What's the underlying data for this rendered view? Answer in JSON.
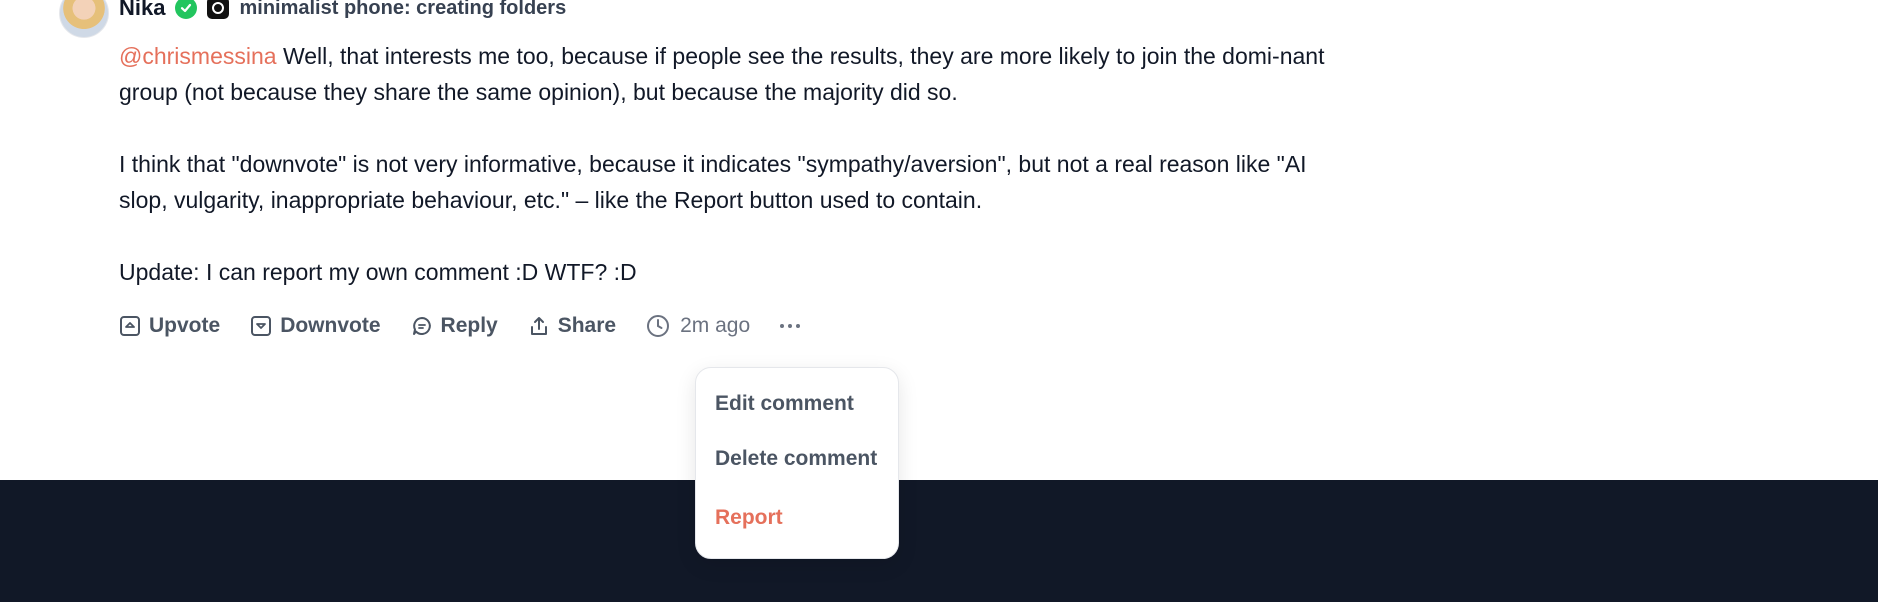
{
  "comment": {
    "author": "Nika",
    "product": "minimalist phone: creating folders",
    "mention": "@chrismessina",
    "paragraph1": " Well, that interests me too, because if people see the results, they are more likely to join the domi-nant group (not because they share the same opinion), but because the majority did so.",
    "paragraph2": "I think that \"downvote\" is not very informative, because it indicates \"sympathy/aversion\", but not a real reason like \"AI slop, vulgarity, inappropriate behaviour, etc.\" – like the Report button used to contain.",
    "paragraph3": "Update: I can report my own comment :D WTF? :D"
  },
  "actions": {
    "upvote": "Upvote",
    "downvote": "Downvote",
    "reply": "Reply",
    "share": "Share",
    "time": "2m ago"
  },
  "menu": {
    "edit": "Edit comment",
    "delete": "Delete comment",
    "report": "Report"
  },
  "icons": {
    "verified": "verified-check-icon",
    "product": "product-logo-icon",
    "upvote": "upvote-icon",
    "downvote": "downvote-icon",
    "reply": "reply-bubble-icon",
    "share": "share-icon",
    "time": "clock-icon",
    "more": "more-dots-icon"
  },
  "colors": {
    "mention": "#e5705b",
    "report": "#e5705b",
    "verified": "#22c55e",
    "footer": "#111827"
  }
}
